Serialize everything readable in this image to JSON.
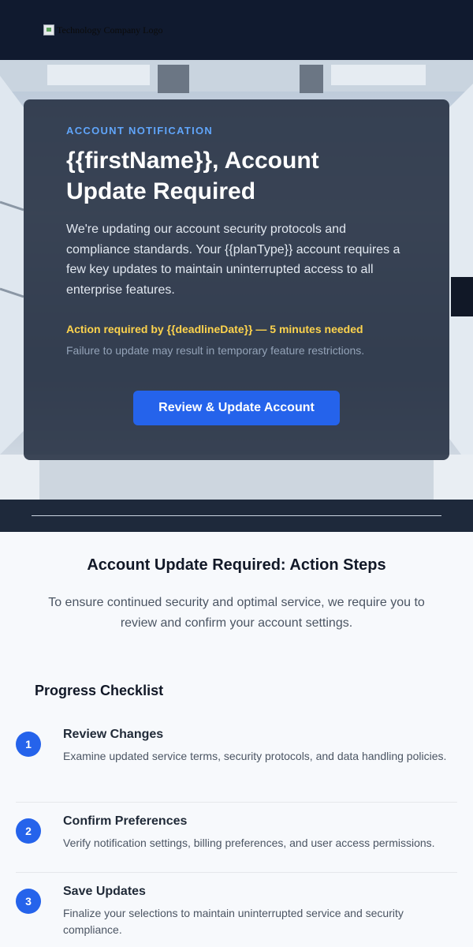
{
  "header": {
    "logo_alt": "Technology Company Logo"
  },
  "hero": {
    "eyebrow": "ACCOUNT NOTIFICATION",
    "title": "{{firstName}}, Account Update Required",
    "body": "We're updating our account security protocols and compliance standards. Your {{planType}} account requires a few key updates to maintain uninterrupted access to all enterprise features.",
    "deadline": "Action required by {{deadlineDate}} — 5 minutes needed",
    "warning": "Failure to update may result in temporary feature restrictions.",
    "cta_label": "Review & Update Account"
  },
  "content": {
    "title": "Account Update Required: Action Steps",
    "intro": "To ensure continued security and optimal service, we require you to review and confirm your account settings.",
    "checklist_title": "Progress Checklist",
    "steps": [
      {
        "number": "1",
        "title": "Review Changes",
        "description": "Examine updated service terms, security protocols, and data handling policies."
      },
      {
        "number": "2",
        "title": "Confirm Preferences",
        "description": "Verify notification settings, billing preferences, and user access permissions."
      },
      {
        "number": "3",
        "title": "Save Updates",
        "description": "Finalize your selections to maintain uninterrupted service and security compliance."
      }
    ]
  },
  "colors": {
    "header_bg": "#101a2f",
    "accent": "#2563eb",
    "eyebrow": "#60a5fa",
    "deadline": "#fcd34d"
  }
}
